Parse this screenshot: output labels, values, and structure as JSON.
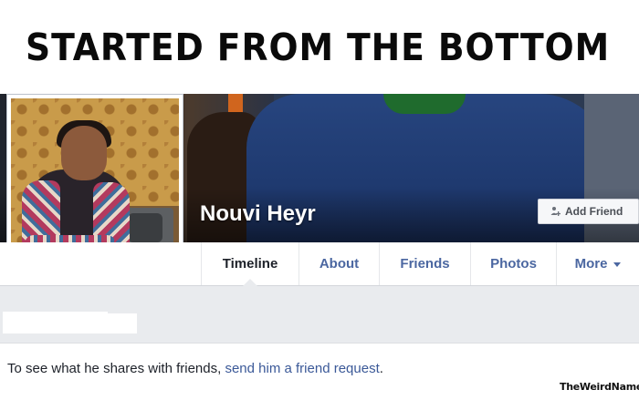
{
  "meme": {
    "caption": "STARTED FROM THE BOTTOM",
    "watermark": "TheWeirdNames"
  },
  "profile": {
    "name": "Nouvi Heyr",
    "add_friend_label": "Add Friend",
    "add_friend_icon": "add-friend-icon"
  },
  "nav": {
    "tabs": [
      {
        "label": "Timeline",
        "active": true
      },
      {
        "label": "About",
        "active": false
      },
      {
        "label": "Friends",
        "active": false
      },
      {
        "label": "Photos",
        "active": false
      },
      {
        "label": "More",
        "active": false
      }
    ]
  },
  "content": {
    "prefix": "To see what he shares with friends, ",
    "link": "send him a friend request",
    "suffix": "."
  },
  "colors": {
    "link": "#3b5998",
    "nav_text": "#4b67a1",
    "band": "#e9ebee"
  }
}
